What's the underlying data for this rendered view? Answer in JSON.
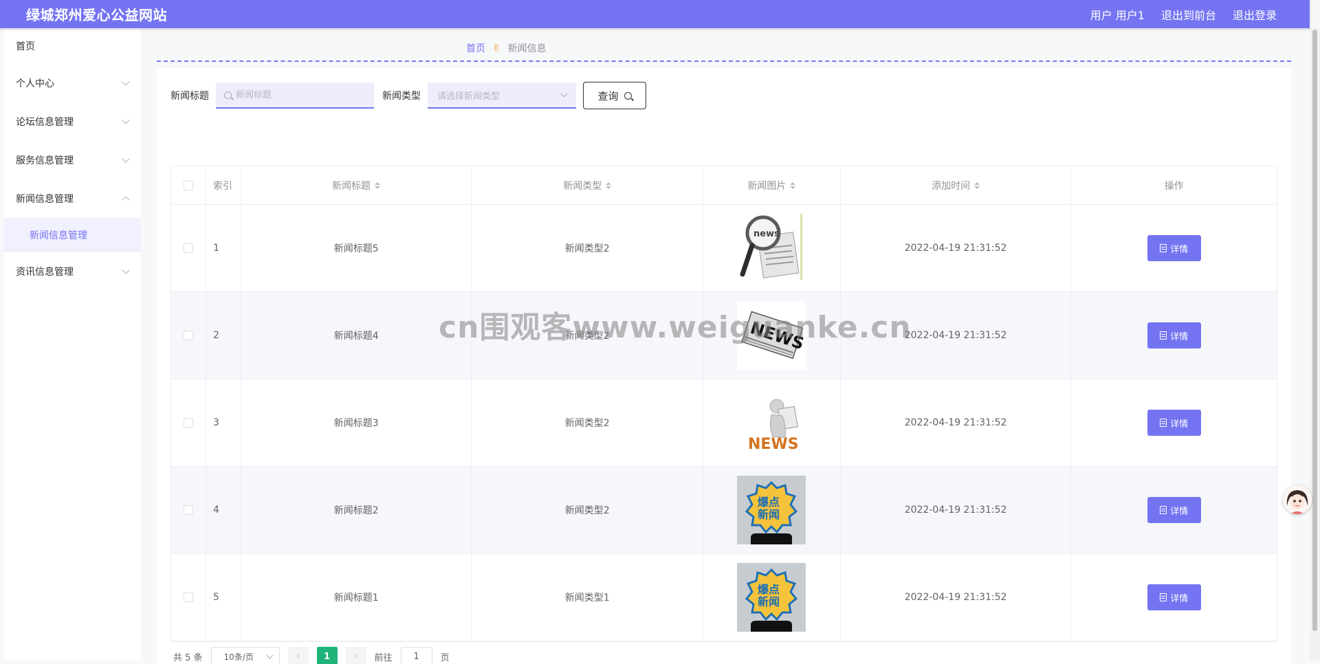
{
  "header": {
    "site_title": "绿城郑州爱心公益网站",
    "user_label": "用户 用户1",
    "back_front_label": "退出到前台",
    "logout_label": "退出登录"
  },
  "sidebar": {
    "items": [
      {
        "label": "首页"
      },
      {
        "label": "个人中心"
      },
      {
        "label": "论坛信息管理"
      },
      {
        "label": "服务信息管理"
      },
      {
        "label": "新闻信息管理"
      },
      {
        "label": "资讯信息管理"
      }
    ],
    "sub_items": [
      {
        "label": "新闻信息管理"
      }
    ]
  },
  "breadcrumb": {
    "home": "首页",
    "current": "新闻信息"
  },
  "search": {
    "title_label": "新闻标题",
    "title_placeholder": "新闻标题",
    "type_label": "新闻类型",
    "type_placeholder": "请选择新闻类型",
    "query_label": "查询"
  },
  "table": {
    "headers": {
      "index": "索引",
      "title": "新闻标题",
      "type": "新闻类型",
      "image": "新闻图片",
      "time": "添加时间",
      "operation": "操作"
    },
    "detail_label": "详情",
    "rows": [
      {
        "index": "1",
        "title": "新闻标题5",
        "type": "新闻类型2",
        "time": "2022-04-19 21:31:52"
      },
      {
        "index": "2",
        "title": "新闻标题4",
        "type": "新闻类型2",
        "time": "2022-04-19 21:31:52"
      },
      {
        "index": "3",
        "title": "新闻标题3",
        "type": "新闻类型2",
        "time": "2022-04-19 21:31:52"
      },
      {
        "index": "4",
        "title": "新闻标题2",
        "type": "新闻类型2",
        "time": "2022-04-19 21:31:52"
      },
      {
        "index": "5",
        "title": "新闻标题1",
        "type": "新闻类型1",
        "time": "2022-04-19 21:31:52"
      }
    ]
  },
  "pagination": {
    "total": "共 5 条",
    "page_size": "10条/页",
    "current_page": "1",
    "goto_prefix": "前往",
    "goto_value": "1",
    "goto_suffix": "页"
  },
  "thumb_texts": {
    "news_a": "news",
    "news_b": "NEWS",
    "news_c": "NEWS",
    "baodian_1": "爆点",
    "baodian_2": "新闻"
  },
  "watermark": "cn围观客www.weiguanke.cn",
  "colors": {
    "primary": "#7474f2",
    "page_active": "#1fb37a"
  }
}
